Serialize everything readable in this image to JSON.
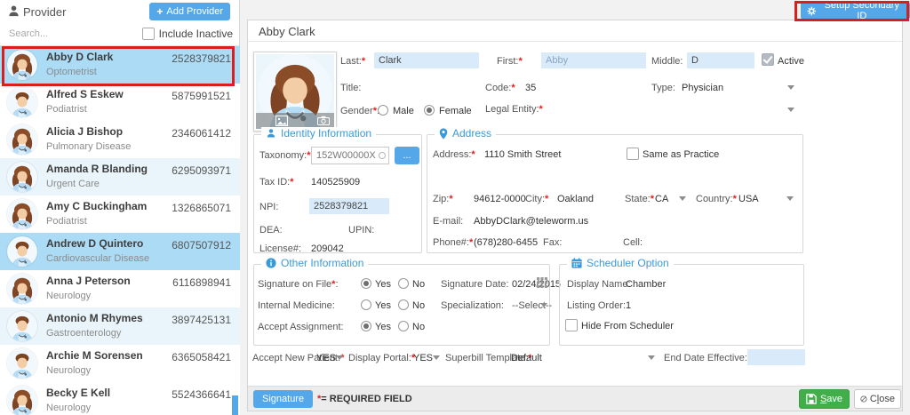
{
  "ui": {
    "required_marker": "*",
    "colon": ":",
    "ellipsis": "...",
    "plus": "+"
  },
  "colors": {
    "accent_blue": "#54a7e9",
    "selected_row": "#abdbf5",
    "alt_row": "#e9f4fb",
    "save_green": "#41ae4a",
    "annotation_red": "#d81e1e",
    "section_title_blue": "#3a9ad9",
    "input_highlight": "#d9eafb"
  },
  "sidebar": {
    "title": "Provider",
    "add_provider_label": "Add Provider",
    "search_placeholder": "Search...",
    "include_inactive_label": "Include Inactive",
    "providers": [
      {
        "name": "Abby D Clark",
        "specialty": "Optometrist",
        "phone": "2528379821"
      },
      {
        "name": "Alfred S Eskew",
        "specialty": "Podiatrist",
        "phone": "5875991521"
      },
      {
        "name": "Alicia J Bishop",
        "specialty": "Pulmonary Disease",
        "phone": "2346061412"
      },
      {
        "name": "Amanda R Blanding",
        "specialty": "Urgent Care",
        "phone": "6295093971"
      },
      {
        "name": "Amy C Buckingham",
        "specialty": "Podiatrist",
        "phone": "1326865071"
      },
      {
        "name": "Andrew D Quintero",
        "specialty": "Cardiovascular Disease",
        "phone": "6807507912"
      },
      {
        "name": "Anna J Peterson",
        "specialty": "Neurology",
        "phone": "6116898941"
      },
      {
        "name": "Antonio M Rhymes",
        "specialty": "Gastroenterology",
        "phone": "3897425131"
      },
      {
        "name": "Archie M Sorensen",
        "specialty": "Neurology",
        "phone": "6365058421"
      },
      {
        "name": "Becky E Kell",
        "specialty": "Neurology",
        "phone": "5524366641"
      }
    ]
  },
  "toolbar": {
    "setup_secondary_id_label": "Setup Secondary ID"
  },
  "detail": {
    "header": "Abby Clark",
    "name_row": {
      "last_label": "Last:",
      "last_value": "Clark",
      "first_label": "First:",
      "first_value": "Abby",
      "middle_label": "Middle:",
      "middle_value": "D",
      "active_label": "Active"
    },
    "info_row": {
      "title_label": "Title:",
      "code_label": "Code:",
      "code_value": "35",
      "type_label": "Type:",
      "type_value": "Physician"
    },
    "gender_row": {
      "gender_label": "Gender",
      "male_label": "Male",
      "female_label": "Female",
      "legal_entity_label": "Legal Entity:"
    },
    "identity": {
      "title": "Identity Information",
      "taxonomy_label": "Taxonomy:",
      "taxonomy_value": "152W00000X",
      "tax_id_label": "Tax ID:",
      "tax_id_value": "140525909",
      "npi_label": "NPI:",
      "npi_value": "2528379821",
      "dea_label": "DEA:",
      "upin_label": "UPIN:",
      "license_label": "License#:",
      "license_value": "209042"
    },
    "address": {
      "title": "Address",
      "address_label": "Address:",
      "address_value": "1110 Smith Street",
      "same_as_practice_label": "Same as Practice",
      "zip_label": "Zip:",
      "zip_value": "94612-0000",
      "city_label": "City:",
      "city_value": "Oakland",
      "state_label": "State:",
      "state_value": "CA",
      "country_label": "Country:",
      "country_value": "USA",
      "email_label": "E-mail:",
      "email_value": "AbbyDClark@teleworm.us",
      "phone_label": "Phone#:",
      "phone_value": "(678)280-6455",
      "fax_label": "Fax:",
      "cell_label": "Cell:"
    },
    "other": {
      "title": "Other Information",
      "signature_on_file_label": "Signature on File",
      "yes_label": "Yes",
      "no_label": "No",
      "signature_date_label": "Signature Date:",
      "signature_date_value": "02/24/2015",
      "internal_medicine_label": "Internal Medicine:",
      "specialization_label": "Specialization:",
      "specialization_value": "--Select--",
      "accept_assignment_label": "Accept Assignment:"
    },
    "scheduler": {
      "title": "Scheduler Option",
      "display_name_label": "Display Name:",
      "display_name_value": "Chamber",
      "listing_order_label": "Listing Order:",
      "listing_order_value": "1",
      "hide_from_scheduler_label": "Hide From Scheduler"
    },
    "bottom_row": {
      "accept_new_patient_label": "Accept New Patient:",
      "accept_new_patient_value": "YES",
      "display_portal_label": "Display Portal:",
      "display_portal_value": "YES",
      "superbill_template_label": "Superbill Template:",
      "superbill_template_value": "Default",
      "end_date_effective_label": "End Date Effective:"
    },
    "footer": {
      "signature_label": "Signature",
      "required_note": "= REQUIRED FIELD",
      "save_key": "S",
      "save_rest": "ave",
      "close_pre": "C",
      "close_key": "l",
      "close_rest": "ose"
    }
  }
}
